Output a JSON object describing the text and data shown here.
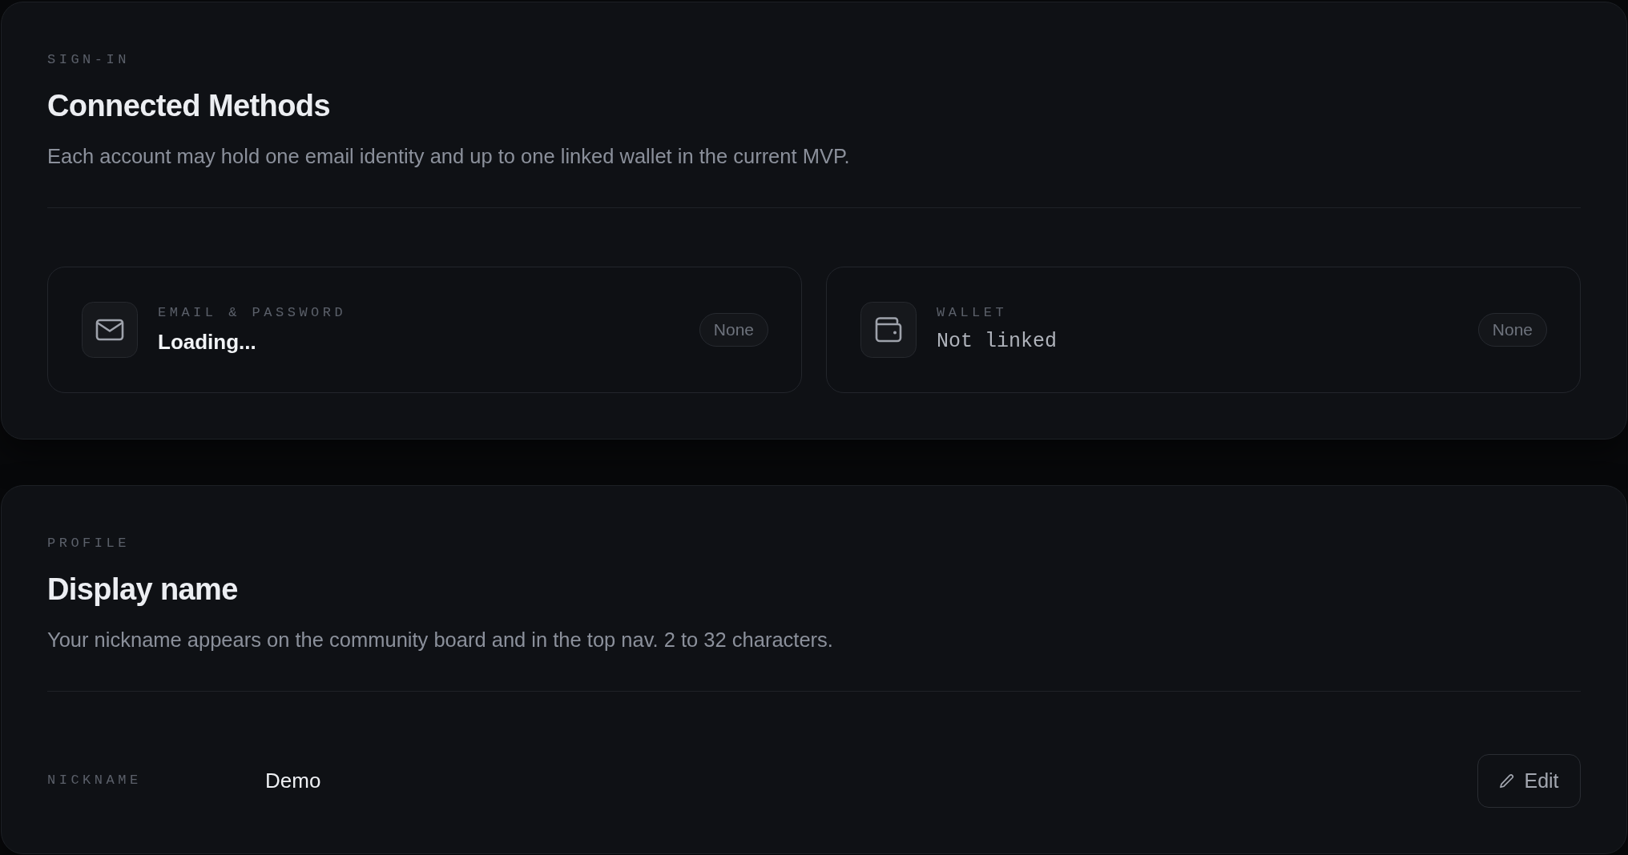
{
  "sign_in": {
    "eyebrow": "SIGN-IN",
    "title": "Connected Methods",
    "description": "Each account may hold one email identity and up to one linked wallet in the current MVP.",
    "methods": [
      {
        "kind": "email",
        "label": "EMAIL & PASSWORD",
        "value": "Loading...",
        "badge": "None"
      },
      {
        "kind": "wallet",
        "label": "WALLET",
        "value": "Not linked",
        "badge": "None"
      }
    ]
  },
  "profile": {
    "eyebrow": "PROFILE",
    "title": "Display name",
    "description": "Your nickname appears on the community board and in the top nav. 2 to 32 characters.",
    "fields": [
      {
        "label": "NICKNAME",
        "value": "Demo",
        "action": "Edit"
      }
    ]
  }
}
